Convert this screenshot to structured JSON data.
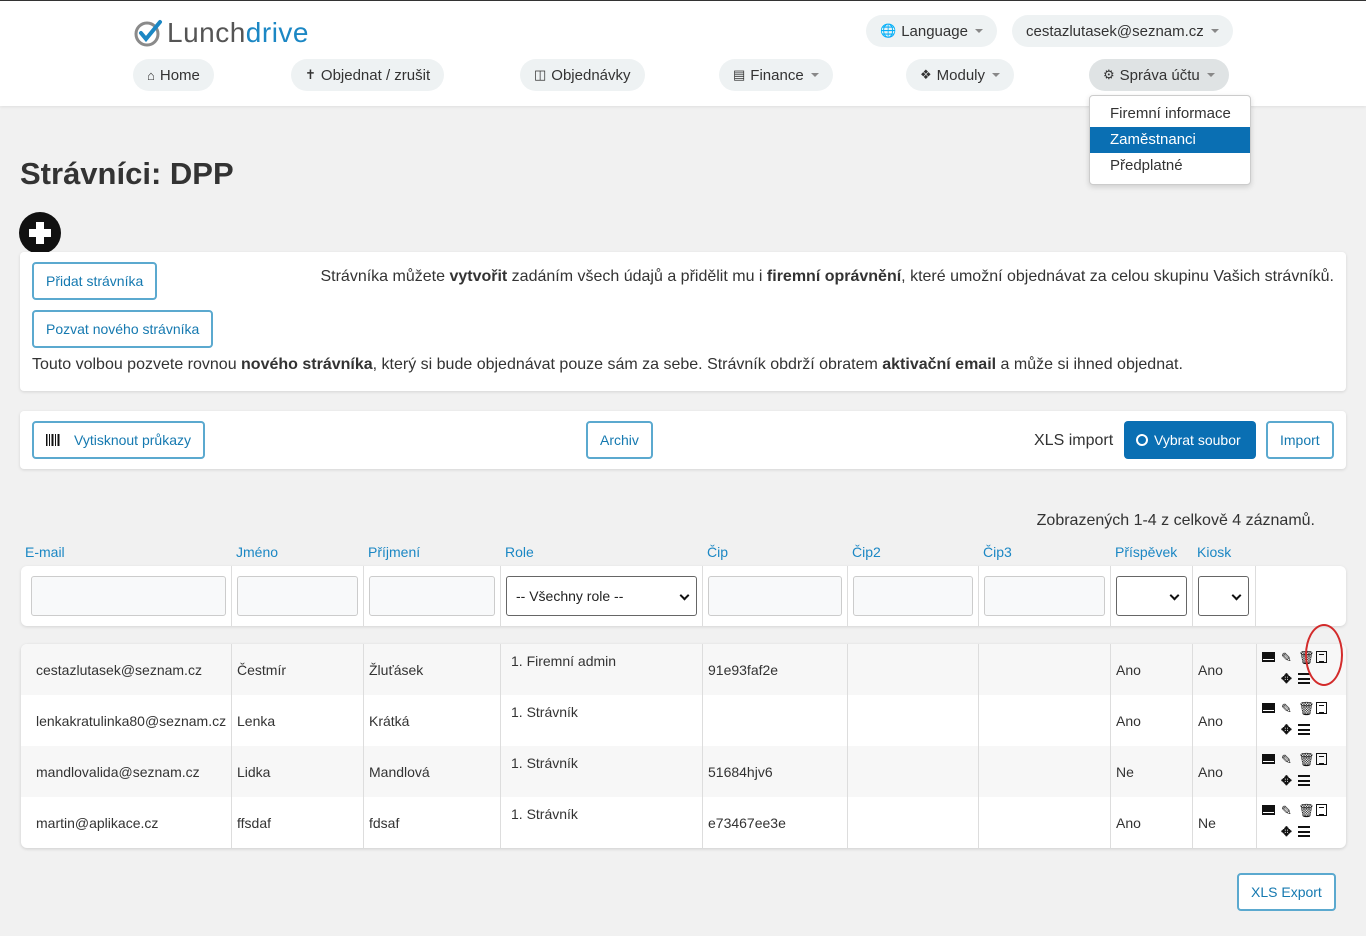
{
  "header": {
    "logo_lunch": "Lunch",
    "logo_drive": "drive",
    "language_label": "Language",
    "user_email": "cestazlutasek@seznam.cz",
    "nav": {
      "home": "Home",
      "order": "Objednat / zrušit",
      "orders": "Objednávky",
      "finance": "Finance",
      "modules": "Moduly",
      "account": "Správa účtu"
    },
    "account_menu": [
      "Firemní informace",
      "Zaměstnanci",
      "Předplatné"
    ],
    "account_menu_selected": "Zaměstnanci"
  },
  "page": {
    "title": "Strávníci: DPP"
  },
  "add_card": {
    "add_button": "Přidat strávníka",
    "invite_button": "Pozvat nového strávníka",
    "add_text_1": "Strávníka můžete ",
    "add_text_b1": "vytvořit",
    "add_text_2": " zadáním všech údajů a přidělit mu i ",
    "add_text_b2": "firemní oprávnění",
    "add_text_3": ", které umožní objednávat za celou skupinu Vašich strávníků.",
    "invite_text_1": "Touto volbou pozvete rovnou ",
    "invite_text_b1": "nového strávníka",
    "invite_text_2": ", který si bude objednávat pouze sám za sebe. Strávník obdrží obratem ",
    "invite_text_b2": "aktivační email",
    "invite_text_3": " a může si ihned objednat."
  },
  "tools": {
    "print_cards": "Vytisknout průkazy",
    "archive": "Archiv",
    "xls_import_label": "XLS import",
    "choose_file": "Vybrat soubor",
    "import": "Import"
  },
  "table": {
    "summary": "Zobrazených 1-4 z celkově 4 záznamů.",
    "columns": [
      "E-mail",
      "Jméno",
      "Příjmení",
      "Role",
      "Čip",
      "Čip2",
      "Čip3",
      "Příspěvek",
      "Kiosk"
    ],
    "role_filter_value": "-- Všechny role --",
    "rows": [
      {
        "email": "cestazlutasek@seznam.cz",
        "first": "Čestmír",
        "last": "Žluťásek",
        "role": "1. Firemní admin",
        "chip": "91e93faf2e",
        "chip2": "",
        "chip3": "",
        "contribution": "Ano",
        "kiosk": "Ano"
      },
      {
        "email": "lenkakratulinka80@seznam.cz",
        "first": "Lenka",
        "last": "Krátká",
        "role": "1. Strávník",
        "chip": "",
        "chip2": "",
        "chip3": "",
        "contribution": "Ano",
        "kiosk": "Ano"
      },
      {
        "email": "mandlovalida@seznam.cz",
        "first": "Lidka",
        "last": "Mandlová",
        "role": "1. Strávník",
        "chip": "51684hjv6",
        "chip2": "",
        "chip3": "",
        "contribution": "Ne",
        "kiosk": "Ano"
      },
      {
        "email": "martin@aplikace.cz",
        "first": "ffsdaf",
        "last": "fdsaf",
        "role": "1. Strávník",
        "chip": "e73467ee3e",
        "chip2": "",
        "chip3": "",
        "contribution": "Ano",
        "kiosk": "Ne"
      }
    ]
  },
  "footer": {
    "xls_export": "XLS Export"
  }
}
